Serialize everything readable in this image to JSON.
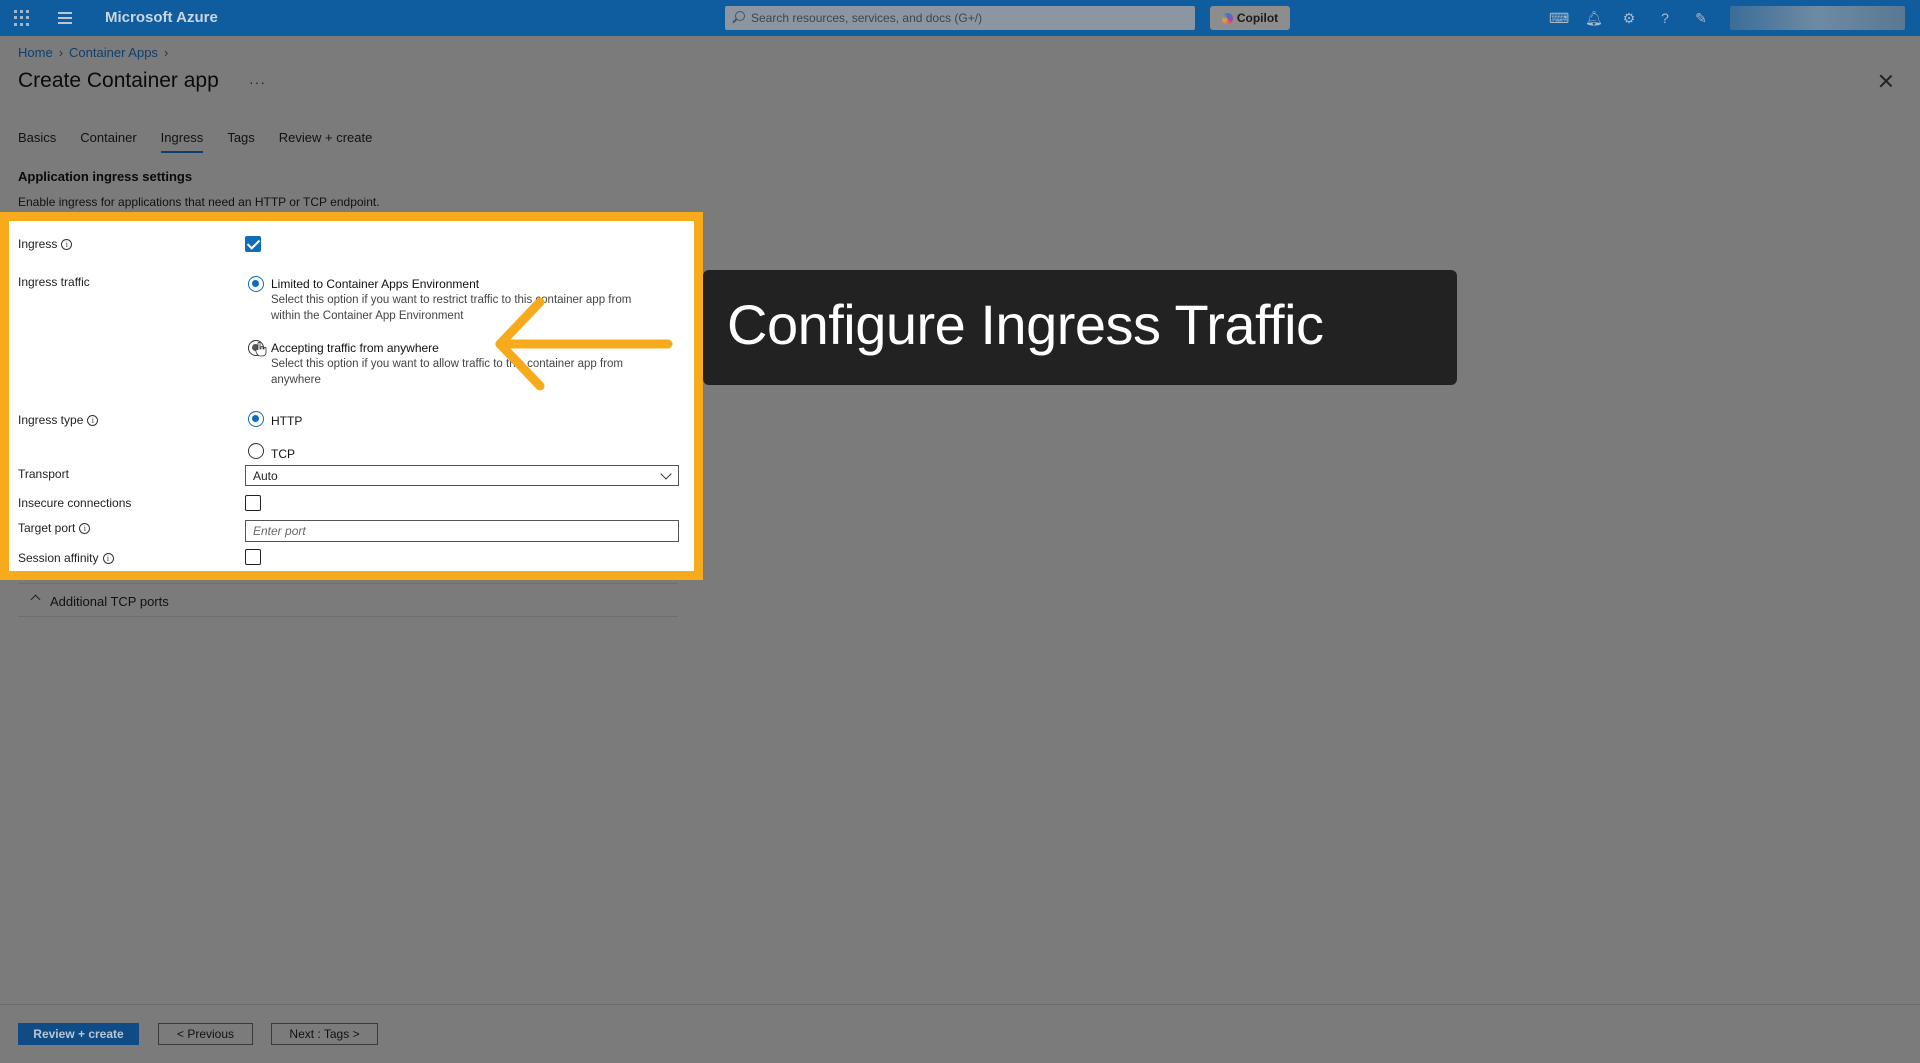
{
  "topbar": {
    "brand": "Microsoft Azure",
    "search_placeholder": "Search resources, services, and docs (G+/)",
    "copilot_label": "Copilot",
    "icons": [
      "cloud-shell-icon",
      "bell-icon",
      "gear-icon",
      "help-icon",
      "feedback-icon"
    ]
  },
  "breadcrumb": {
    "items": [
      "Home",
      "Container Apps"
    ]
  },
  "page": {
    "title": "Create Container app",
    "more": "···"
  },
  "tabs": [
    {
      "label": "Basics",
      "active": false
    },
    {
      "label": "Container",
      "active": false
    },
    {
      "label": "Ingress",
      "active": true
    },
    {
      "label": "Tags",
      "active": false
    },
    {
      "label": "Review + create",
      "active": false
    }
  ],
  "section": {
    "title": "Application ingress settings",
    "description": "Enable ingress for applications that need an HTTP or TCP endpoint."
  },
  "form": {
    "ingress": {
      "label": "Ingress",
      "checked": true
    },
    "ingress_traffic": {
      "label": "Ingress traffic",
      "options": [
        {
          "title": "Limited to Container Apps Environment",
          "desc": "Select this option if you want to restrict traffic to this container app from within the Container App Environment",
          "selected": true
        },
        {
          "title": "Accepting traffic from anywhere",
          "desc": "Select this option if you want to allow traffic to this container app from anywhere",
          "selected": false
        }
      ]
    },
    "ingress_type": {
      "label": "Ingress type",
      "options": [
        {
          "title": "HTTP",
          "selected": true
        },
        {
          "title": "TCP",
          "selected": false
        }
      ]
    },
    "transport": {
      "label": "Transport",
      "value": "Auto"
    },
    "insecure": {
      "label": "Insecure connections",
      "checked": false
    },
    "target_port": {
      "label": "Target port",
      "placeholder": "Enter port"
    },
    "session_affinity": {
      "label": "Session affinity",
      "checked": false
    }
  },
  "additional_tcp": {
    "label": "Additional TCP ports"
  },
  "callout": {
    "text": "Configure Ingress Traffic",
    "highlight_color": "#f6aa1c"
  },
  "footer": {
    "review": "Review + create",
    "previous": "< Previous",
    "next": "Next : Tags >"
  }
}
